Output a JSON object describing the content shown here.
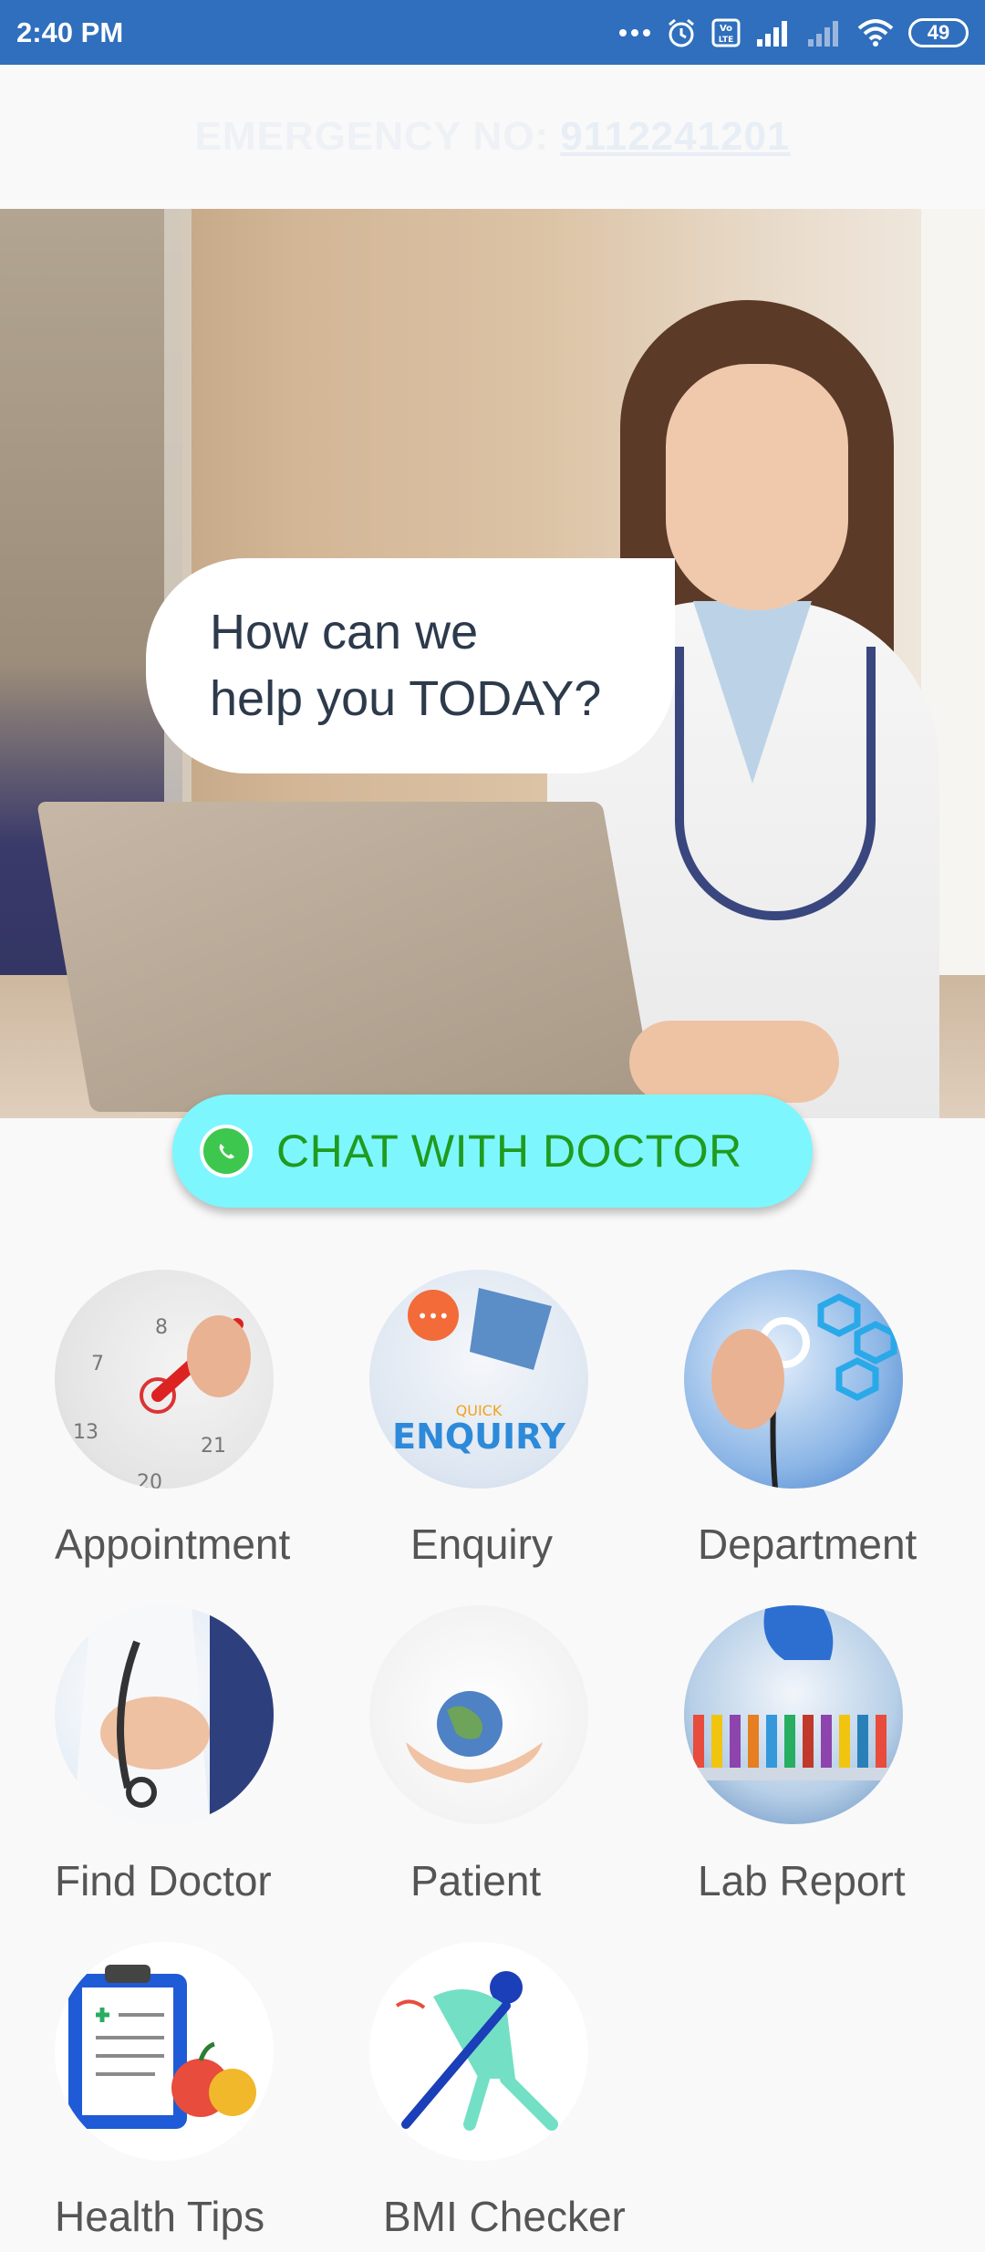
{
  "status_bar": {
    "time": "2:40 PM",
    "battery": "49",
    "icons": [
      "more-dots-icon",
      "alarm-icon",
      "volte-icon",
      "signal-icon",
      "signal-weak-icon",
      "wifi-icon",
      "battery-icon"
    ]
  },
  "emergency": {
    "label": "EMERGENCY NO:",
    "number": "9112241201"
  },
  "hero": {
    "speech_line1": "How can we",
    "speech_line2": "help you TODAY?"
  },
  "chat_button": {
    "label": "CHAT WITH DOCTOR",
    "icon": "whatsapp-icon"
  },
  "menu": {
    "appointment": "Appointment",
    "enquiry": "Enquiry",
    "enquiry_badge_small": "QUICK",
    "enquiry_badge_big": "ENQUIRY",
    "department": "Department",
    "find_doctor": "Find Doctor",
    "patient": "Patient",
    "lab_report": "Lab Report",
    "health_tips": "Health Tips",
    "bmi_checker": "BMI Checker"
  },
  "colors": {
    "status_bar": "#2f6fbd",
    "chat_button_bg": "#7ef6fd",
    "chat_button_text": "#1f9b1f"
  }
}
